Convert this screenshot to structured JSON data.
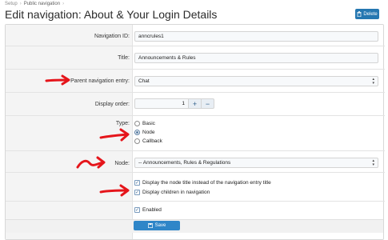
{
  "breadcrumb": {
    "items": [
      "Setup",
      "Public navigation"
    ]
  },
  "page_title": "Edit navigation: About & Your Login Details",
  "delete_label": "Delete",
  "form": {
    "navigation_id_label": "Navigation ID:",
    "navigation_id_value": "anncrules1",
    "title_label": "Title:",
    "title_value": "Announcements & Rules",
    "parent_label": "Parent navigation entry:",
    "parent_value": "Chat",
    "display_order_label": "Display order:",
    "display_order_value": "1",
    "increment_label": "+",
    "decrement_label": "−",
    "type_label": "Type:",
    "type_options": [
      "Basic",
      "Node",
      "Callback"
    ],
    "type_selected": "Node",
    "node_label": "Node:",
    "node_value": "-- Announcements, Rules & Regulations",
    "checkbox_title": "Display the node title instead of the navigation entry title",
    "checkbox_children": "Display children in navigation",
    "enabled_label": "Enabled"
  },
  "save_label": "Save",
  "colors": {
    "accent": "#2f86c8",
    "annotation": "#e5151b"
  },
  "icons": {
    "delete": "trash-icon",
    "save": "save-icon"
  }
}
